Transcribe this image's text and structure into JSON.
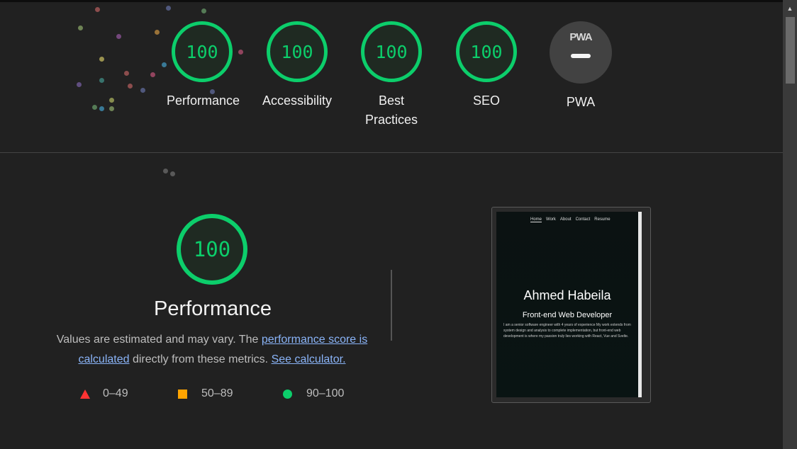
{
  "scores": [
    {
      "value": "100",
      "label": "Performance"
    },
    {
      "value": "100",
      "label": "Accessibility"
    },
    {
      "value": "100",
      "label": "Best Practices"
    },
    {
      "value": "100",
      "label": "SEO"
    }
  ],
  "pwa": {
    "label": "PWA",
    "badge_text": "PWA"
  },
  "main": {
    "score": "100",
    "title": "Performance",
    "desc_pre": "Values are estimated and may vary. The ",
    "desc_link1": "performance score is calculated",
    "desc_mid": " directly from these metrics. ",
    "desc_link2": "See calculator."
  },
  "legend": [
    "0–49",
    "50–89",
    "90–100"
  ],
  "colors": {
    "pass": "#0cce6b",
    "average": "#ffa400",
    "fail": "#ff3333"
  },
  "thumbnail": {
    "nav": [
      "Home",
      "Work",
      "About",
      "Contact",
      "Resume"
    ],
    "name": "Ahmed Habeila",
    "role": "Front-end Web Developer",
    "bio": "I am a senior software engineer with 4 years of experience My work extends from system design and analysis to complete implementation, but front-end web development is where my passion truly lies working with React, Vue and Svelte."
  }
}
